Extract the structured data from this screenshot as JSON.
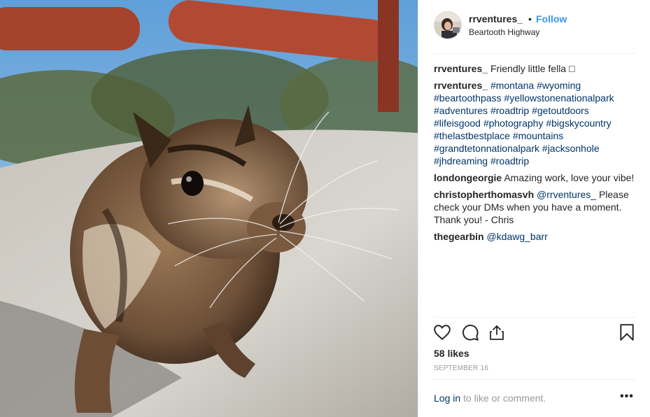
{
  "post": {
    "username": "rrventures_",
    "separator": "•",
    "follow_label": "Follow",
    "location": "Beartooth Highway",
    "likes": "58 likes",
    "date": "SEPTEMBER 16",
    "login_link": "Log in",
    "login_suffix": " to like or comment.",
    "more_label": "•••"
  },
  "comments": [
    {
      "user": "rrventures_",
      "text": "Friendly little fella □"
    },
    {
      "user": "rrventures_",
      "hashtags": [
        "#montana",
        "#wyoming",
        "#beartoothpass",
        "#yellowstonenationalpark",
        "#adventures",
        "#roadtrip",
        "#getoutdoors",
        "#lifeisgood",
        "#photography",
        "#bigskycountry",
        "#thelastbestplace",
        "#mountains",
        "#grandtetonnationalpark",
        "#jacksonhole",
        "#jhdreaming",
        "#roadtrip"
      ]
    },
    {
      "user": "londongeorgie",
      "text": "Amazing work, love your vibe!"
    },
    {
      "user": "christopherthomasvh",
      "mention": "@rrventures_",
      "text": " Please check your DMs when you have a moment. Thank you! - Chris"
    },
    {
      "user": "thegearbin",
      "mention": "@kdawg_barr",
      "text": ""
    }
  ],
  "icons": {
    "like": "heart-icon",
    "comment": "comment-icon",
    "share": "share-icon",
    "save": "bookmark-icon"
  },
  "colors": {
    "link_blue": "#3897f0",
    "hashtag_navy": "#003569",
    "text": "#262626",
    "muted": "#999999"
  }
}
